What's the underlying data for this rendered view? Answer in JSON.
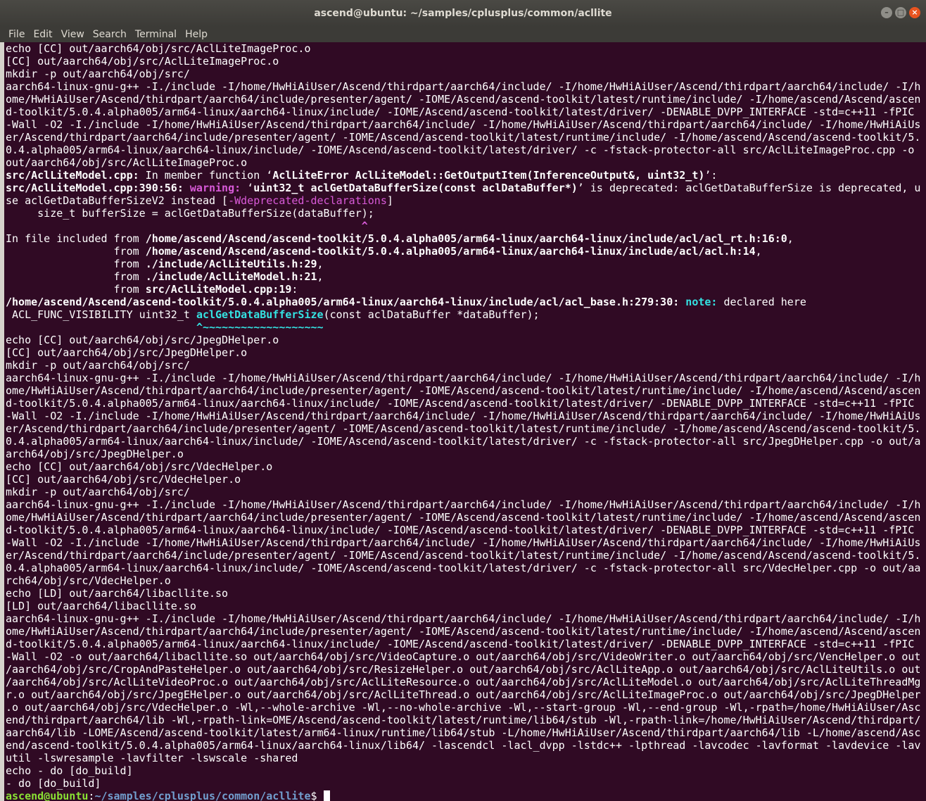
{
  "window": {
    "title": "ascend@ubuntu: ~/samples/cplusplus/common/acllite",
    "minimize": "–",
    "maximize": "□",
    "close": "×"
  },
  "menu": [
    "File",
    "Edit",
    "View",
    "Search",
    "Terminal",
    "Help"
  ],
  "colors": {
    "background": "#300a24",
    "text": "#ffffff",
    "warning": "#d85ad8",
    "note": "#34e2e2",
    "prompt_user": "#8ae234",
    "prompt_path": "#729fcf"
  },
  "terminal": {
    "lines": [
      {
        "segments": [
          {
            "text": "echo [CC] out/aarch64/obj/src/AclLiteImageProc.o",
            "style": ""
          }
        ]
      },
      {
        "segments": [
          {
            "text": "[CC] out/aarch64/obj/src/AclLiteImageProc.o",
            "style": ""
          }
        ]
      },
      {
        "segments": [
          {
            "text": "mkdir -p out/aarch64/obj/src/",
            "style": ""
          }
        ]
      },
      {
        "segments": [
          {
            "text": "aarch64-linux-gnu-g++ -I./include -I/home/HwHiAiUser/Ascend/thirdpart/aarch64/include/ -I/home/HwHiAiUser/Ascend/thirdpart/aarch64/include/ -I/h",
            "style": ""
          }
        ]
      },
      {
        "segments": [
          {
            "text": "ome/HwHiAiUser/Ascend/thirdpart/aarch64/include/presenter/agent/ -IOME/Ascend/ascend-toolkit/latest/runtime/include/ -I/home/ascend/Ascend/ascen",
            "style": ""
          }
        ]
      },
      {
        "segments": [
          {
            "text": "d-toolkit/5.0.4.alpha005/arm64-linux/aarch64-linux/include/ -IOME/Ascend/ascend-toolkit/latest/driver/ -DENABLE_DVPP_INTERFACE -std=c++11 -fPIC",
            "style": ""
          }
        ]
      },
      {
        "segments": [
          {
            "text": "-Wall -O2 -I./include -I/home/HwHiAiUser/Ascend/thirdpart/aarch64/include/ -I/home/HwHiAiUser/Ascend/thirdpart/aarch64/include/ -I/home/HwHiAiUs",
            "style": ""
          }
        ]
      },
      {
        "segments": [
          {
            "text": "er/Ascend/thirdpart/aarch64/include/presenter/agent/ -IOME/Ascend/ascend-toolkit/latest/runtime/include/ -I/home/ascend/Ascend/ascend-toolkit/5.",
            "style": ""
          }
        ]
      },
      {
        "segments": [
          {
            "text": "0.4.alpha005/arm64-linux/aarch64-linux/include/ -IOME/Ascend/ascend-toolkit/latest/driver/ -c -fstack-protector-all src/AclLiteImageProc.cpp -o",
            "style": ""
          }
        ]
      },
      {
        "segments": [
          {
            "text": "out/aarch64/obj/src/AclLiteImageProc.o",
            "style": ""
          }
        ]
      },
      {
        "segments": [
          {
            "text": "src/AclLiteModel.cpp:",
            "style": "b"
          },
          {
            "text": " In member function ‘",
            "style": ""
          },
          {
            "text": "AclLiteError AclLiteModel::GetOutputItem(InferenceOutput&, uint32_t)",
            "style": "b"
          },
          {
            "text": "’:",
            "style": ""
          }
        ]
      },
      {
        "segments": [
          {
            "text": "src/AclLiteModel.cpp:390:56:",
            "style": "b"
          },
          {
            "text": " ",
            "style": ""
          },
          {
            "text": "warning:",
            "style": "mag"
          },
          {
            "text": " ‘",
            "style": ""
          },
          {
            "text": "uint32_t aclGetDataBufferSize(const aclDataBuffer*)",
            "style": "b"
          },
          {
            "text": "’ is deprecated: aclGetDataBufferSize is deprecated, u",
            "style": ""
          }
        ]
      },
      {
        "segments": [
          {
            "text": "se aclGetDataBufferSizeV2 instead [",
            "style": ""
          },
          {
            "text": "-Wdeprecated-declarations",
            "style": "magl"
          },
          {
            "text": "]",
            "style": ""
          }
        ]
      },
      {
        "segments": [
          {
            "text": "     size_t bufferSize = aclGetDataBufferSize(dataBuffer);",
            "style": ""
          }
        ]
      },
      {
        "segments": [
          {
            "text": "                                                        ",
            "style": ""
          },
          {
            "text": "^",
            "style": "mag"
          }
        ]
      },
      {
        "segments": [
          {
            "text": "In file included from ",
            "style": ""
          },
          {
            "text": "/home/ascend/Ascend/ascend-toolkit/5.0.4.alpha005/arm64-linux/aarch64-linux/include/acl/acl_rt.h:16:0",
            "style": "b"
          },
          {
            "text": ",",
            "style": ""
          }
        ]
      },
      {
        "segments": [
          {
            "text": "                 from ",
            "style": ""
          },
          {
            "text": "/home/ascend/Ascend/ascend-toolkit/5.0.4.alpha005/arm64-linux/aarch64-linux/include/acl/acl.h:14",
            "style": "b"
          },
          {
            "text": ",",
            "style": ""
          }
        ]
      },
      {
        "segments": [
          {
            "text": "                 from ",
            "style": ""
          },
          {
            "text": "./include/AclLiteUtils.h:29",
            "style": "b"
          },
          {
            "text": ",",
            "style": ""
          }
        ]
      },
      {
        "segments": [
          {
            "text": "                 from ",
            "style": ""
          },
          {
            "text": "./include/AclLiteModel.h:21",
            "style": "b"
          },
          {
            "text": ",",
            "style": ""
          }
        ]
      },
      {
        "segments": [
          {
            "text": "                 from ",
            "style": ""
          },
          {
            "text": "src/AclLiteModel.cpp:19",
            "style": "b"
          },
          {
            "text": ":",
            "style": ""
          }
        ]
      },
      {
        "segments": [
          {
            "text": "/home/ascend/Ascend/ascend-toolkit/5.0.4.alpha005/arm64-linux/aarch64-linux/include/acl/acl_base.h:279:30:",
            "style": "b"
          },
          {
            "text": " ",
            "style": ""
          },
          {
            "text": "note:",
            "style": "cyb"
          },
          {
            "text": " declared here",
            "style": ""
          }
        ]
      },
      {
        "segments": [
          {
            "text": " ACL_FUNC_VISIBILITY uint32_t ",
            "style": ""
          },
          {
            "text": "aclGetDataBufferSize",
            "style": "cyb"
          },
          {
            "text": "(const aclDataBuffer *dataBuffer);",
            "style": ""
          }
        ]
      },
      {
        "segments": [
          {
            "text": "                              ",
            "style": ""
          },
          {
            "text": "^~~~~~~~~~~~~~~~~~~~",
            "style": "cyb"
          }
        ]
      },
      {
        "segments": [
          {
            "text": "echo [CC] out/aarch64/obj/src/JpegDHelper.o",
            "style": ""
          }
        ]
      },
      {
        "segments": [
          {
            "text": "[CC] out/aarch64/obj/src/JpegDHelper.o",
            "style": ""
          }
        ]
      },
      {
        "segments": [
          {
            "text": "mkdir -p out/aarch64/obj/src/",
            "style": ""
          }
        ]
      },
      {
        "segments": [
          {
            "text": "aarch64-linux-gnu-g++ -I./include -I/home/HwHiAiUser/Ascend/thirdpart/aarch64/include/ -I/home/HwHiAiUser/Ascend/thirdpart/aarch64/include/ -I/h",
            "style": ""
          }
        ]
      },
      {
        "segments": [
          {
            "text": "ome/HwHiAiUser/Ascend/thirdpart/aarch64/include/presenter/agent/ -IOME/Ascend/ascend-toolkit/latest/runtime/include/ -I/home/ascend/Ascend/ascen",
            "style": ""
          }
        ]
      },
      {
        "segments": [
          {
            "text": "d-toolkit/5.0.4.alpha005/arm64-linux/aarch64-linux/include/ -IOME/Ascend/ascend-toolkit/latest/driver/ -DENABLE_DVPP_INTERFACE -std=c++11 -fPIC",
            "style": ""
          }
        ]
      },
      {
        "segments": [
          {
            "text": "-Wall -O2 -I./include -I/home/HwHiAiUser/Ascend/thirdpart/aarch64/include/ -I/home/HwHiAiUser/Ascend/thirdpart/aarch64/include/ -I/home/HwHiAiUs",
            "style": ""
          }
        ]
      },
      {
        "segments": [
          {
            "text": "er/Ascend/thirdpart/aarch64/include/presenter/agent/ -IOME/Ascend/ascend-toolkit/latest/runtime/include/ -I/home/ascend/Ascend/ascend-toolkit/5.",
            "style": ""
          }
        ]
      },
      {
        "segments": [
          {
            "text": "0.4.alpha005/arm64-linux/aarch64-linux/include/ -IOME/Ascend/ascend-toolkit/latest/driver/ -c -fstack-protector-all src/JpegDHelper.cpp -o out/a",
            "style": ""
          }
        ]
      },
      {
        "segments": [
          {
            "text": "arch64/obj/src/JpegDHelper.o",
            "style": ""
          }
        ]
      },
      {
        "segments": [
          {
            "text": "echo [CC] out/aarch64/obj/src/VdecHelper.o",
            "style": ""
          }
        ]
      },
      {
        "segments": [
          {
            "text": "[CC] out/aarch64/obj/src/VdecHelper.o",
            "style": ""
          }
        ]
      },
      {
        "segments": [
          {
            "text": "mkdir -p out/aarch64/obj/src/",
            "style": ""
          }
        ]
      },
      {
        "segments": [
          {
            "text": "aarch64-linux-gnu-g++ -I./include -I/home/HwHiAiUser/Ascend/thirdpart/aarch64/include/ -I/home/HwHiAiUser/Ascend/thirdpart/aarch64/include/ -I/h",
            "style": ""
          }
        ]
      },
      {
        "segments": [
          {
            "text": "ome/HwHiAiUser/Ascend/thirdpart/aarch64/include/presenter/agent/ -IOME/Ascend/ascend-toolkit/latest/runtime/include/ -I/home/ascend/Ascend/ascen",
            "style": ""
          }
        ]
      },
      {
        "segments": [
          {
            "text": "d-toolkit/5.0.4.alpha005/arm64-linux/aarch64-linux/include/ -IOME/Ascend/ascend-toolkit/latest/driver/ -DENABLE_DVPP_INTERFACE -std=c++11 -fPIC",
            "style": ""
          }
        ]
      },
      {
        "segments": [
          {
            "text": "-Wall -O2 -I./include -I/home/HwHiAiUser/Ascend/thirdpart/aarch64/include/ -I/home/HwHiAiUser/Ascend/thirdpart/aarch64/include/ -I/home/HwHiAiUs",
            "style": ""
          }
        ]
      },
      {
        "segments": [
          {
            "text": "er/Ascend/thirdpart/aarch64/include/presenter/agent/ -IOME/Ascend/ascend-toolkit/latest/runtime/include/ -I/home/ascend/Ascend/ascend-toolkit/5.",
            "style": ""
          }
        ]
      },
      {
        "segments": [
          {
            "text": "0.4.alpha005/arm64-linux/aarch64-linux/include/ -IOME/Ascend/ascend-toolkit/latest/driver/ -c -fstack-protector-all src/VdecHelper.cpp -o out/aa",
            "style": ""
          }
        ]
      },
      {
        "segments": [
          {
            "text": "rch64/obj/src/VdecHelper.o",
            "style": ""
          }
        ]
      },
      {
        "segments": [
          {
            "text": "echo [LD] out/aarch64/libacllite.so",
            "style": ""
          }
        ]
      },
      {
        "segments": [
          {
            "text": "[LD] out/aarch64/libacllite.so",
            "style": ""
          }
        ]
      },
      {
        "segments": [
          {
            "text": "aarch64-linux-gnu-g++ -I./include -I/home/HwHiAiUser/Ascend/thirdpart/aarch64/include/ -I/home/HwHiAiUser/Ascend/thirdpart/aarch64/include/ -I/h",
            "style": ""
          }
        ]
      },
      {
        "segments": [
          {
            "text": "ome/HwHiAiUser/Ascend/thirdpart/aarch64/include/presenter/agent/ -IOME/Ascend/ascend-toolkit/latest/runtime/include/ -I/home/ascend/Ascend/ascen",
            "style": ""
          }
        ]
      },
      {
        "segments": [
          {
            "text": "d-toolkit/5.0.4.alpha005/arm64-linux/aarch64-linux/include/ -IOME/Ascend/ascend-toolkit/latest/driver/ -DENABLE_DVPP_INTERFACE -std=c++11 -fPIC",
            "style": ""
          }
        ]
      },
      {
        "segments": [
          {
            "text": "-Wall -O2 -o out/aarch64/libacllite.so out/aarch64/obj/src/VideoCapture.o out/aarch64/obj/src/VideoWriter.o out/aarch64/obj/src/VencHelper.o out",
            "style": ""
          }
        ]
      },
      {
        "segments": [
          {
            "text": "/aarch64/obj/src/CropAndPasteHelper.o out/aarch64/obj/src/ResizeHelper.o out/aarch64/obj/src/AclLiteApp.o out/aarch64/obj/src/AclLiteUtils.o out",
            "style": ""
          }
        ]
      },
      {
        "segments": [
          {
            "text": "/aarch64/obj/src/AclLiteVideoProc.o out/aarch64/obj/src/AclLiteResource.o out/aarch64/obj/src/AclLiteModel.o out/aarch64/obj/src/AclLiteThreadMg",
            "style": ""
          }
        ]
      },
      {
        "segments": [
          {
            "text": "r.o out/aarch64/obj/src/JpegEHelper.o out/aarch64/obj/src/AclLiteThread.o out/aarch64/obj/src/AclLiteImageProc.o out/aarch64/obj/src/JpegDHelper",
            "style": ""
          }
        ]
      },
      {
        "segments": [
          {
            "text": ".o out/aarch64/obj/src/VdecHelper.o -Wl,--whole-archive -Wl,--no-whole-archive -Wl,--start-group -Wl,--end-group -Wl,-rpath=/home/HwHiAiUser/Asc",
            "style": ""
          }
        ]
      },
      {
        "segments": [
          {
            "text": "end/thirdpart/aarch64/lib -Wl,-rpath-link=OME/Ascend/ascend-toolkit/latest/runtime/lib64/stub -Wl,-rpath-link=/home/HwHiAiUser/Ascend/thirdpart/",
            "style": ""
          }
        ]
      },
      {
        "segments": [
          {
            "text": "aarch64/lib -LOME/Ascend/ascend-toolkit/latest/arm64-linux/runtime/lib64/stub -L/home/HwHiAiUser/Ascend/thirdpart/aarch64/lib -L/home/ascend/Asc",
            "style": ""
          }
        ]
      },
      {
        "segments": [
          {
            "text": "end/ascend-toolkit/5.0.4.alpha005/arm64-linux/aarch64-linux/lib64/ -lascendcl -lacl_dvpp -lstdc++ -lpthread -lavcodec -lavformat -lavdevice -lav",
            "style": ""
          }
        ]
      },
      {
        "segments": [
          {
            "text": "util -lswresample -lavfilter -lswscale -shared",
            "style": ""
          }
        ]
      },
      {
        "segments": [
          {
            "text": "echo - do [do_build]",
            "style": ""
          }
        ]
      },
      {
        "segments": [
          {
            "text": "- do [do_build]",
            "style": ""
          }
        ]
      }
    ],
    "prompt": {
      "user": "ascend@ubuntu",
      "sep": ":",
      "path": "~/samples/cplusplus/common/acllite",
      "symbol": "$ "
    }
  }
}
